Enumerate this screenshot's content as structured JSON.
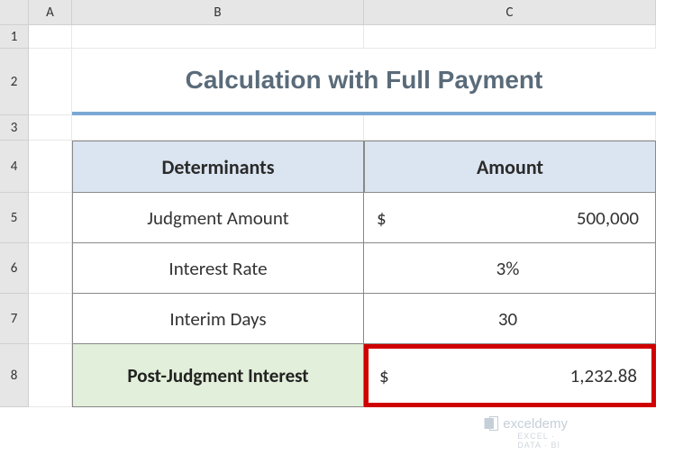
{
  "columns": {
    "A": "A",
    "B": "B",
    "C": "C"
  },
  "rows": {
    "r1": "1",
    "r2": "2",
    "r3": "3",
    "r4": "4",
    "r5": "5",
    "r6": "6",
    "r7": "7",
    "r8": "8"
  },
  "title": "Calculation with Full Payment",
  "headers": {
    "determinants": "Determinants",
    "amount": "Amount"
  },
  "table": {
    "row1": {
      "label": "Judgment Amount",
      "currency": "$",
      "value": "500,000"
    },
    "row2": {
      "label": "Interest Rate",
      "value": "3%"
    },
    "row3": {
      "label": "Interim Days",
      "value": "30"
    },
    "row4": {
      "label": "Post-Judgment Interest",
      "currency": "$",
      "value": "1,232.88"
    }
  },
  "watermark": {
    "brand": "exceldemy",
    "tagline": "EXCEL · DATA · BI"
  }
}
